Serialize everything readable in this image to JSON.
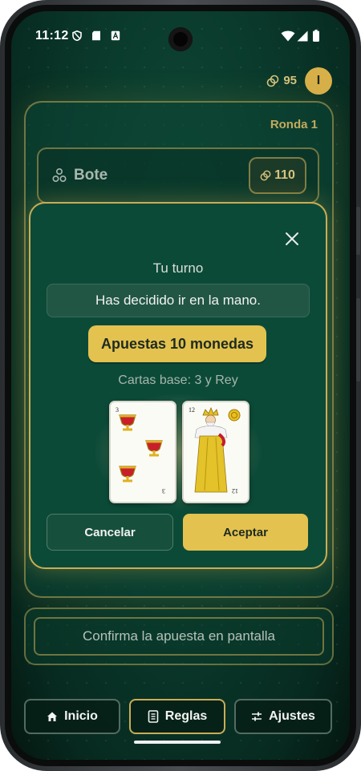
{
  "status_bar": {
    "time": "11:12"
  },
  "header": {
    "coins": "95",
    "avatar_initial": "I"
  },
  "board": {
    "round_label": "Ronda 1",
    "pot_label": "Bote",
    "pot_amount": "110"
  },
  "modal": {
    "title": "Tu turno",
    "message": "Has decidido ir en la mano.",
    "bet_label": "Apuestas 10 monedas",
    "base_cards_label": "Cartas base: 3 y Rey",
    "cards": [
      {
        "rank": "3",
        "suit": "copas"
      },
      {
        "rank": "12",
        "suit": "oros"
      }
    ],
    "cancel_label": "Cancelar",
    "accept_label": "Aceptar"
  },
  "confirm_label": "Confirma la apuesta en pantalla",
  "nav": {
    "items": [
      {
        "label": "Inicio",
        "icon": "home-icon"
      },
      {
        "label": "Reglas",
        "icon": "book-icon"
      },
      {
        "label": "Ajustes",
        "icon": "sliders-icon"
      }
    ]
  },
  "colors": {
    "accent_gold": "#e3c24f",
    "background_green": "#0c4a38"
  }
}
